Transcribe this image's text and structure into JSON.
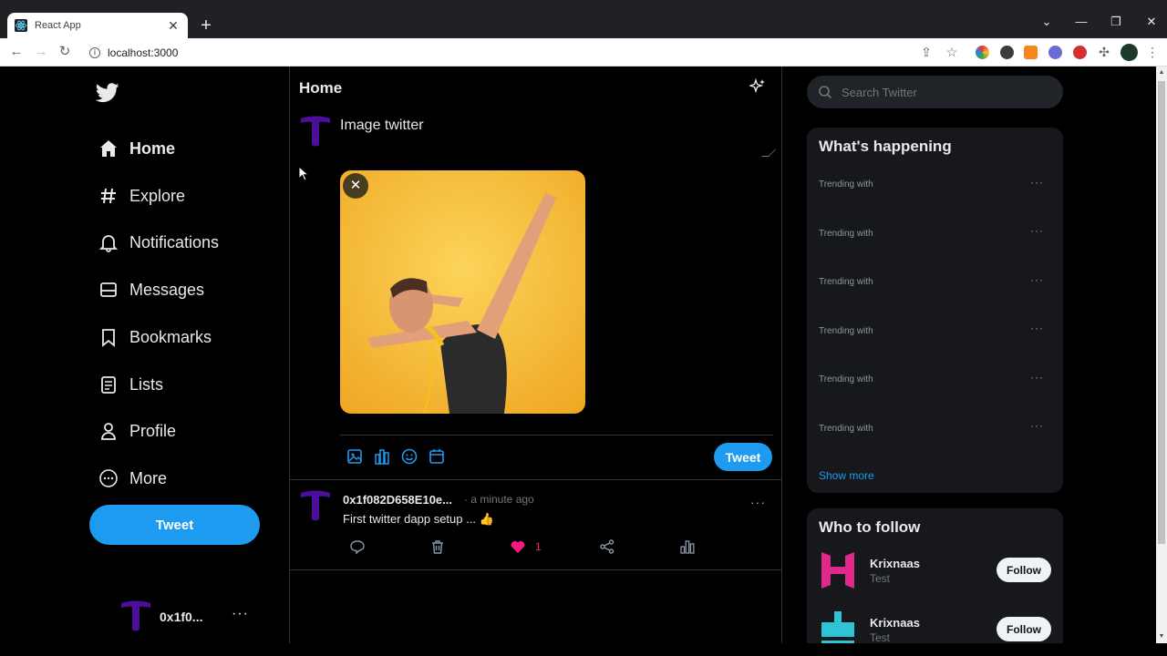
{
  "browser": {
    "tab_title": "React App",
    "url": "localhost:3000",
    "new_tab": "+",
    "tab_close": "✕"
  },
  "sidebar": {
    "nav": [
      {
        "label": "Home",
        "icon": "home-icon",
        "active": true
      },
      {
        "label": "Explore",
        "icon": "hashtag-icon"
      },
      {
        "label": "Notifications",
        "icon": "bell-icon"
      },
      {
        "label": "Messages",
        "icon": "mail-icon"
      },
      {
        "label": "Bookmarks",
        "icon": "bookmark-icon"
      },
      {
        "label": "Lists",
        "icon": "list-icon"
      },
      {
        "label": "Profile",
        "icon": "user-icon"
      },
      {
        "label": "More",
        "icon": "more-circle-icon"
      }
    ],
    "tweet_button": "Tweet",
    "account_name": "0x1f0...",
    "account_more": "···"
  },
  "feed": {
    "title": "Home",
    "compose_text": "Image twitter",
    "image_close": "✕",
    "tweet_button": "Tweet",
    "post": {
      "handle": "0x1f082D658E10e...",
      "time": "· a minute ago",
      "text": "First twitter dapp setup ... 👍",
      "likes": "1",
      "more": "···"
    }
  },
  "right": {
    "search_placeholder": "Search Twitter",
    "whats_happening_title": "What's happening",
    "trends": [
      "Trending with",
      "Trending with",
      "Trending with",
      "Trending with",
      "Trending with",
      "Trending with"
    ],
    "trend_more": "···",
    "show_more": "Show more",
    "who_to_follow_title": "Who to follow",
    "follow": [
      {
        "name": "Krixnaas",
        "sub": "Test",
        "button": "Follow",
        "avatar_color": "#e0298a"
      },
      {
        "name": "Krixnaas",
        "sub": "Test",
        "button": "Follow",
        "avatar_color": "#2ec4d6"
      }
    ]
  },
  "colors": {
    "accent": "#1d9bf0",
    "like": "#f91880",
    "avatar_purple": "#4b0f9c"
  }
}
